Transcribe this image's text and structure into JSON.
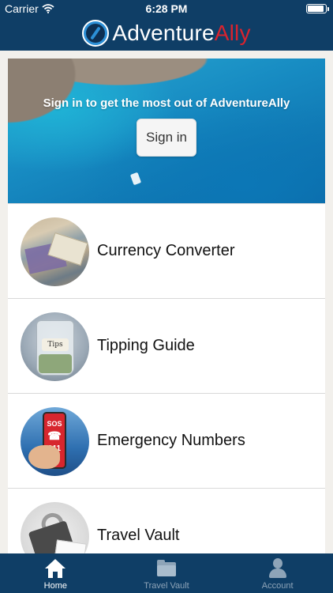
{
  "status_bar": {
    "carrier": "Carrier",
    "time": "6:28 PM"
  },
  "header": {
    "brand_part1": "Adventure",
    "brand_part2": "Ally",
    "brand_color_1": "#ffffff",
    "brand_color_2": "#d9232e",
    "background": "#0f3e66"
  },
  "hero": {
    "tagline": "Sign in to get the most out of AdventureAlly",
    "signin_label": "Sign in"
  },
  "menu": {
    "items": [
      {
        "label": "Currency Converter",
        "icon": "currency-notes-image"
      },
      {
        "label": "Tipping Guide",
        "icon": "tip-jar-image"
      },
      {
        "label": "Emergency Numbers",
        "icon": "sos-phone-image"
      },
      {
        "label": "Travel Vault",
        "icon": "padlock-image"
      }
    ]
  },
  "tabs": [
    {
      "label": "Home",
      "icon": "home-icon",
      "active": true
    },
    {
      "label": "Travel Vault",
      "icon": "folder-icon",
      "active": false
    },
    {
      "label": "Account",
      "icon": "person-icon",
      "active": false
    }
  ],
  "colors": {
    "tab_active": "#ffffff",
    "tab_inactive": "#8ea4b8"
  }
}
